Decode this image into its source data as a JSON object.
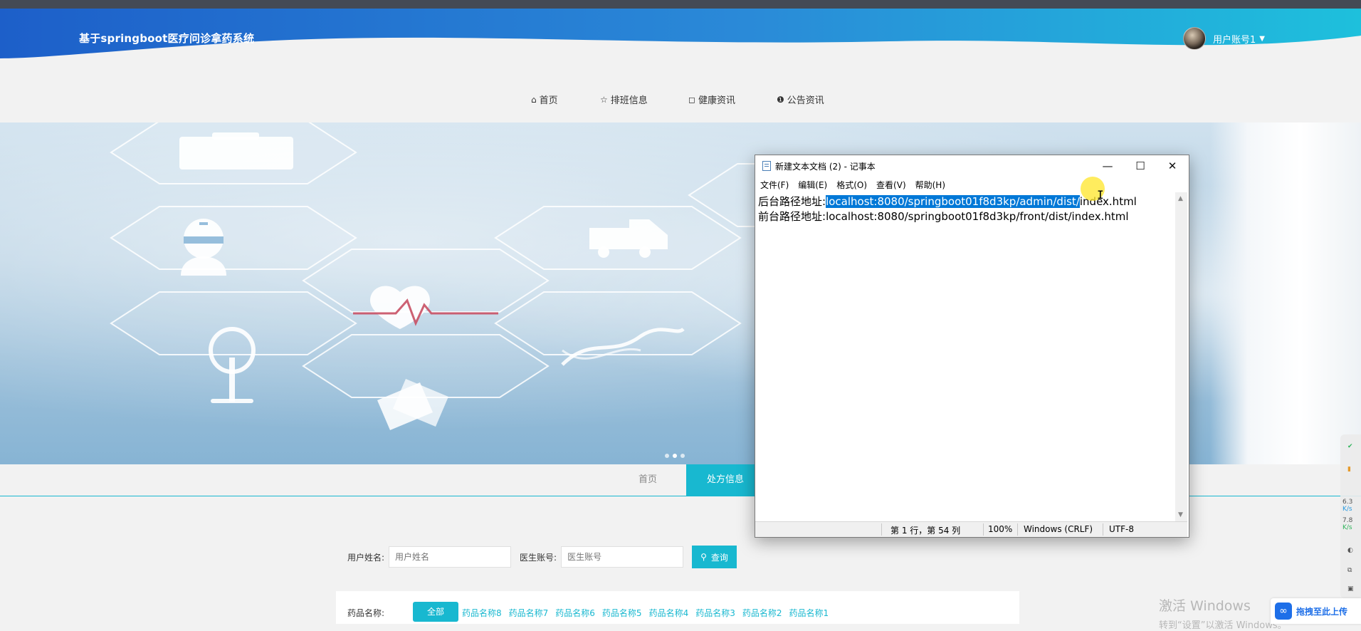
{
  "site": {
    "title": "基于springboot医疗问诊拿药系统"
  },
  "user": {
    "name": "用户账号1",
    "caret": "▼"
  },
  "nav": [
    {
      "icon": "⌂",
      "label": "首页"
    },
    {
      "icon": "☆",
      "label": "排班信息"
    },
    {
      "icon": "◻",
      "label": "健康资讯"
    },
    {
      "icon": "❶",
      "label": "公告资讯"
    }
  ],
  "subtabs": {
    "home": "首页",
    "active": "处方信息"
  },
  "search": {
    "username_label": "用户姓名:",
    "username_placeholder": "用户姓名",
    "doctor_label": "医生账号:",
    "doctor_placeholder": "医生账号",
    "button_icon": "⚲",
    "button_label": "查询"
  },
  "filter": {
    "label": "药品名称:",
    "all": "全部",
    "items": [
      "药品名称8",
      "药品名称7",
      "药品名称6",
      "药品名称5",
      "药品名称4",
      "药品名称3",
      "药品名称2",
      "药品名称1"
    ]
  },
  "notepad": {
    "title": "新建文本文档 (2) - 记事本",
    "controls": {
      "minimize": "—",
      "maximize": "☐",
      "close": "✕"
    },
    "menu": [
      "文件(F)",
      "编辑(E)",
      "格式(O)",
      "查看(V)",
      "帮助(H)"
    ],
    "line1_label": "后台路径地址:",
    "line1_selected": "localhost:8080/springboot01f8d3kp/admin/dist/",
    "line1_rest": "index.html",
    "line2_label": "前台路径地址:",
    "line2_value": "localhost:8080/springboot01f8d3kp/front/dist/index.html",
    "status": {
      "position": "第 1 行，第 54 列",
      "zoom": "100%",
      "eol": "Windows (CRLF)",
      "encoding": "UTF-8"
    }
  },
  "windows_notice": {
    "line1": "激活 Windows",
    "line2": "转到“设置”以激活 Windows。"
  },
  "upload": {
    "label": "拖拽至此上传"
  },
  "tray": {
    "speed_up": "6.3",
    "speed_down": "7.8",
    "unit": "K/s"
  },
  "colors": {
    "accent": "#18b8d0",
    "header_blue": "#1f6fd0",
    "selection": "#0078d7"
  }
}
